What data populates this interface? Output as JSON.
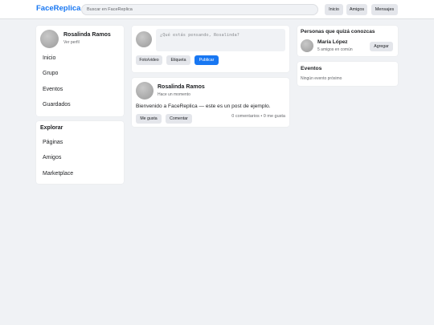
{
  "topbar": {
    "logo": "FaceReplica",
    "search_placeholder": "Buscar en FaceReplica",
    "nav": {
      "home": "Inicio",
      "friends": "Amigos",
      "messages": "Mensajes"
    }
  },
  "profile": {
    "name": "Rosalinda Ramos",
    "link": "Ver perfil"
  },
  "left_menu": [
    "Inicio",
    "Grupo",
    "Eventos",
    "Guardados"
  ],
  "explore": {
    "title": "Explorar",
    "items": [
      "Páginas",
      "Amigos",
      "Marketplace"
    ]
  },
  "composer": {
    "placeholder": "¿Qué estás pensando, Rosalinda?",
    "photo_label": "Foto/video",
    "tag_label": "Etiqueta",
    "publish_label": "Publicar"
  },
  "post": {
    "author": "Rosalinda Ramos",
    "time": "Hace un momento",
    "text": "Bienvenido a FaceReplica — este es un post de ejemplo.",
    "like_label": "Me gusta",
    "comment_label": "Comentar",
    "stats": "0 comentarios • 0 me gusta"
  },
  "suggestions": {
    "title": "Personas que quizá conozcas",
    "person": {
      "name": "María López",
      "mutual": "5 amigos en común",
      "add_label": "Agregar"
    }
  },
  "events": {
    "title": "Eventos",
    "empty": "Ningún evento próximo"
  },
  "colors": {
    "accent": "#1877f2",
    "background": "#f0f2f5",
    "button_gray": "#e4e6eb"
  }
}
